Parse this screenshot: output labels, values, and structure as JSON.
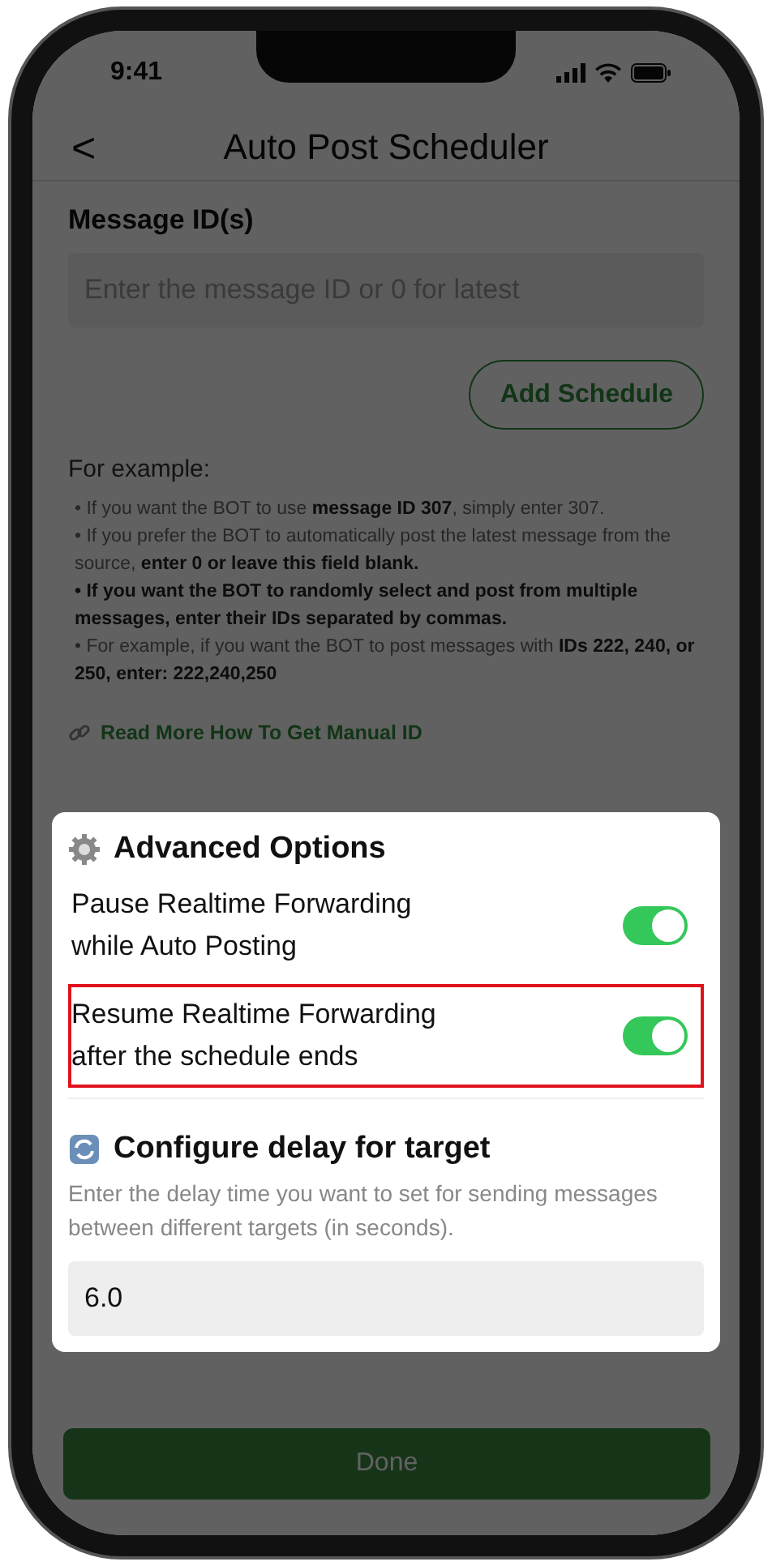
{
  "status_bar": {
    "time": "9:41"
  },
  "header": {
    "back": "<",
    "title": "Auto Post Scheduler"
  },
  "message_ids": {
    "label": "Message ID(s)",
    "placeholder": "Enter the message ID or 0 for latest"
  },
  "add_button": "Add Schedule",
  "example": {
    "title": "For example:",
    "bullets": [
      {
        "text": "• If you want the BOT to use **message ID 307**, simply enter 307.",
        "emphasis": false
      },
      {
        "text": "• If you prefer the BOT to automatically post the latest message from the source, **enter 0 or leave this field blank.**",
        "emphasis": false
      },
      {
        "text": "• If you want the BOT to randomly select and post from multiple messages, enter their IDs separated by commas.",
        "emphasis": true
      },
      {
        "text": "• For example, if you want the BOT to post messages with **IDs 222, 240, or 250, enter: 222,240,250**",
        "emphasis": false
      }
    ]
  },
  "link": "Read More How To Get Manual ID",
  "sheet": {
    "dimmed_background": true,
    "advanced": {
      "title": "Advanced Options",
      "options": [
        {
          "label": "Pause Realtime Forwarding while Auto Posting",
          "on": true,
          "highlighted": false
        },
        {
          "label": "Resume Realtime Forwarding after the schedule ends",
          "on": true,
          "highlighted": true
        }
      ]
    },
    "delay": {
      "title": "Configure delay for target",
      "description": "Enter the delay time you want to set for sending messages between different targets (in seconds).",
      "value": "6.0"
    }
  },
  "done_button": "Done"
}
